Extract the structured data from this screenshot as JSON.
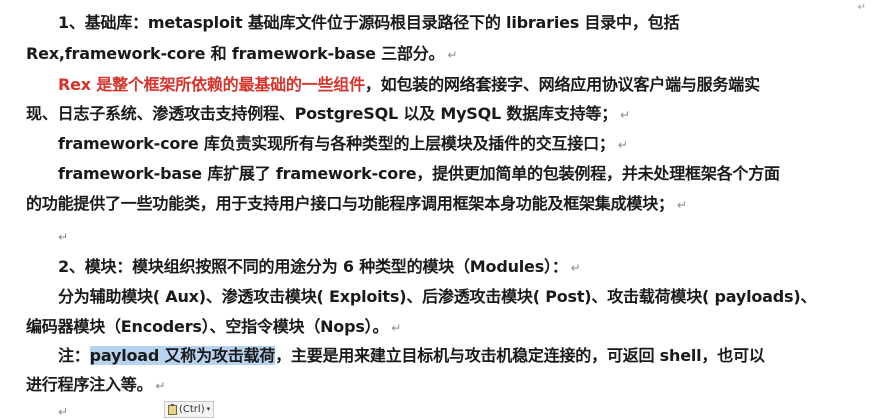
{
  "corner_mark": "↵",
  "paragraph_mark": "↵",
  "paste_options": {
    "label": "(Ctrl)",
    "arrow": "▾"
  },
  "lines": [
    {
      "text": "1、基础库：metasploit 基础库文件位于源码根目录路径下的 libraries 目录中，包括"
    },
    {
      "text": "Rex,framework-core 和 framework-base 三部分。"
    },
    {
      "red": "Rex 是整个框架所依赖的最基础的一些组件",
      "text": "，如包装的网络套接字、网络应用协议客户端与服务端实"
    },
    {
      "text": "现、日志子系统、渗透攻击支持例程、PostgreSQL 以及 MySQL 数据库支持等；"
    },
    {
      "text": "framework-core 库负责实现所有与各种类型的上层模块及插件的交互接口；"
    },
    {
      "text": "framework-base 库扩展了 framework-core，提供更加简单的包装例程，并未处理框架各个方面"
    },
    {
      "text": "的功能提供了一些功能类，用于支持用户接口与功能程序调用框架本身功能及框架集成模块；"
    },
    {
      "text": "2、模块：模块组织按照不同的用途分为 6 种类型的模块（Modules）："
    },
    {
      "text": "分为辅助模块( Aux)、渗透攻击模块( Exploits)、后渗透攻击模块( Post)、攻击载荷模块( payloads)、"
    },
    {
      "text": "编码器模块（Encoders）、空指令模块（Nops）。"
    },
    {
      "prefix": "注：",
      "highlight": "payload 又称为攻击载荷",
      "text": "，主要是用来建立目标机与攻击机稳定连接的，可返回 shell，也可以"
    },
    {
      "text": "进行程序注入等。"
    }
  ]
}
